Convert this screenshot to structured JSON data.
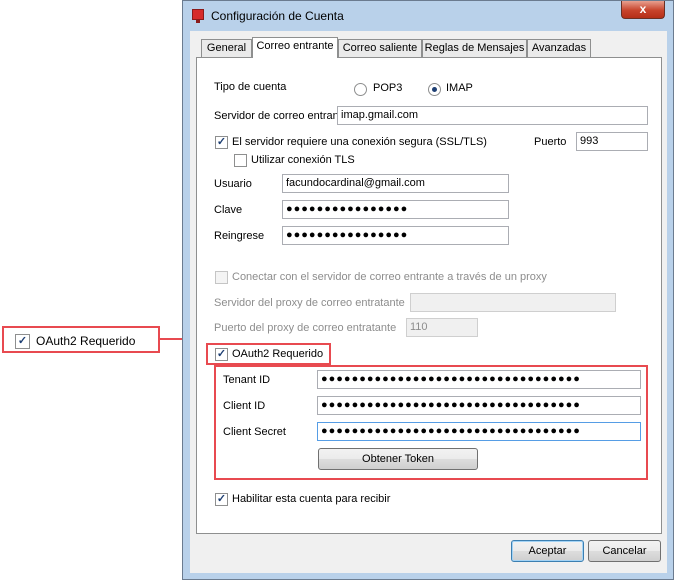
{
  "window": {
    "title": "Configuración de Cuenta",
    "close_glyph": "x",
    "icon": "app-mail-icon"
  },
  "tabs": [
    {
      "label": "General"
    },
    {
      "label": "Correo entrante"
    },
    {
      "label": "Correo saliente"
    },
    {
      "label": "Reglas de Mensajes"
    },
    {
      "label": "Avanzadas"
    }
  ],
  "form": {
    "account_type_label": "Tipo de cuenta",
    "pop3_label": "POP3",
    "imap_label": "IMAP",
    "selected_type": "IMAP",
    "incoming_server_label": "Servidor de correo entrante",
    "incoming_server_value": "imap.gmail.com",
    "ssl_label": "El servidor requiere una conexión segura (SSL/TLS)",
    "ssl_checked": true,
    "port_label": "Puerto",
    "port_value": "993",
    "tls_label": "Utilizar conexión TLS",
    "tls_checked": false,
    "user_label": "Usuario",
    "user_value": "facundocardinal@gmail.com",
    "password_label": "Clave",
    "password_value": "●●●●●●●●●●●●●●●●",
    "reenter_label": "Reingrese",
    "reenter_value": "●●●●●●●●●●●●●●●●",
    "proxy_connect_label": "Conectar con el servidor de correo entrante a través de un proxy",
    "proxy_server_label": "Servidor del proxy de correo entratante",
    "proxy_server_value": "",
    "proxy_port_label": "Puerto del proxy de correo entratante",
    "proxy_port_value": "110",
    "oauth_label": "OAuth2 Requerido",
    "oauth_checked": true,
    "tenant_label": "Tenant ID",
    "tenant_value": "●●●●●●●●●●●●●●●●●●●●●●●●●●●●●●●●●●",
    "client_id_label": "Client ID",
    "client_id_value": "●●●●●●●●●●●●●●●●●●●●●●●●●●●●●●●●●●",
    "client_secret_label": "Client Secret",
    "client_secret_value": "●●●●●●●●●●●●●●●●●●●●●●●●●●●●●●●●●●",
    "get_token_label": "Obtener Token",
    "enable_label": "Habilitar esta cuenta para recibir",
    "enable_checked": true
  },
  "footer": {
    "accept_label": "Aceptar",
    "cancel_label": "Cancelar"
  },
  "callout": {
    "oauth_label": "OAuth2 Requerido",
    "checked": true,
    "highlight_color": "#e84a50"
  },
  "check_glyph": "✓"
}
